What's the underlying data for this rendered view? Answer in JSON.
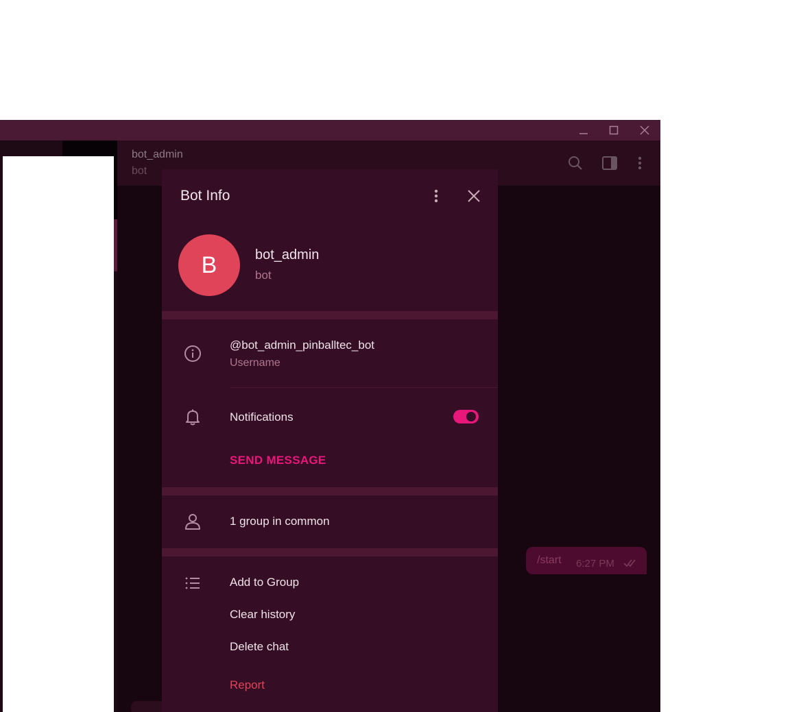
{
  "window": {
    "controls": {
      "minimize": "minimize-icon",
      "maximize": "maximize-icon",
      "close": "close-icon"
    }
  },
  "chat_header": {
    "title": "bot_admin",
    "subtitle": "bot",
    "icons": [
      "search-icon",
      "sidebar-toggle-icon",
      "more-vertical-icon"
    ]
  },
  "message": {
    "text": "/start",
    "time": "6:27 PM"
  },
  "panel": {
    "title": "Bot Info",
    "profile": {
      "initial": "B",
      "name": "bot_admin",
      "role": "bot",
      "avatar_color": "#e04459"
    },
    "username": {
      "value": "@bot_admin_pinballtec_bot",
      "label": "Username"
    },
    "notifications": {
      "label": "Notifications",
      "enabled": true
    },
    "send_message": "SEND MESSAGE",
    "groups_in_common": "1 group in common",
    "actions": {
      "add_to_group": "Add to Group",
      "clear_history": "Clear history",
      "delete_chat": "Delete chat",
      "report": "Report"
    }
  },
  "colors": {
    "accent": "#e8177a",
    "danger": "#e04459",
    "panel_bg": "#350d24",
    "window_bg": "#170610"
  }
}
